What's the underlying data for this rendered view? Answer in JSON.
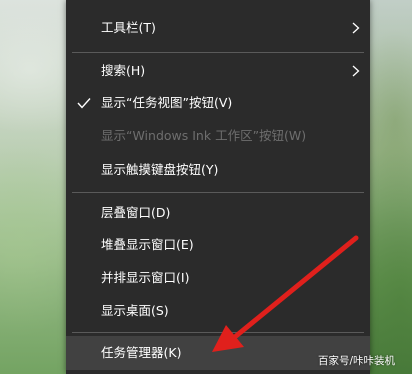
{
  "context_menu": {
    "items": [
      {
        "label": "工具栏(T)",
        "submenu": true,
        "enabled": true,
        "checked": false
      },
      {
        "label": "搜索(H)",
        "submenu": true,
        "enabled": true,
        "checked": false
      },
      {
        "label": "显示“任务视图”按钮(V)",
        "submenu": false,
        "enabled": true,
        "checked": true
      },
      {
        "label": "显示“Windows Ink 工作区”按钮(W)",
        "submenu": false,
        "enabled": false,
        "checked": false
      },
      {
        "label": "显示触摸键盘按钮(Y)",
        "submenu": false,
        "enabled": true,
        "checked": false
      },
      {
        "label": "层叠窗口(D)",
        "submenu": false,
        "enabled": true,
        "checked": false
      },
      {
        "label": "堆叠显示窗口(E)",
        "submenu": false,
        "enabled": true,
        "checked": false
      },
      {
        "label": "并排显示窗口(I)",
        "submenu": false,
        "enabled": true,
        "checked": false
      },
      {
        "label": "显示桌面(S)",
        "submenu": false,
        "enabled": true,
        "checked": false
      },
      {
        "label": "任务管理器(K)",
        "submenu": false,
        "enabled": true,
        "checked": false
      }
    ]
  },
  "watermark": "百家号/咔咔装机",
  "colors": {
    "menu_background": "#2b2b2b",
    "menu_text": "#ffffff",
    "disabled_text": "#6e6e6e",
    "separator": "#5a5a5a",
    "highlight": "#414141",
    "annotation_arrow": "#e0201c"
  },
  "icons": {
    "check": "checkmark-icon",
    "submenu": "chevron-right-icon",
    "annotation": "red-arrow"
  }
}
